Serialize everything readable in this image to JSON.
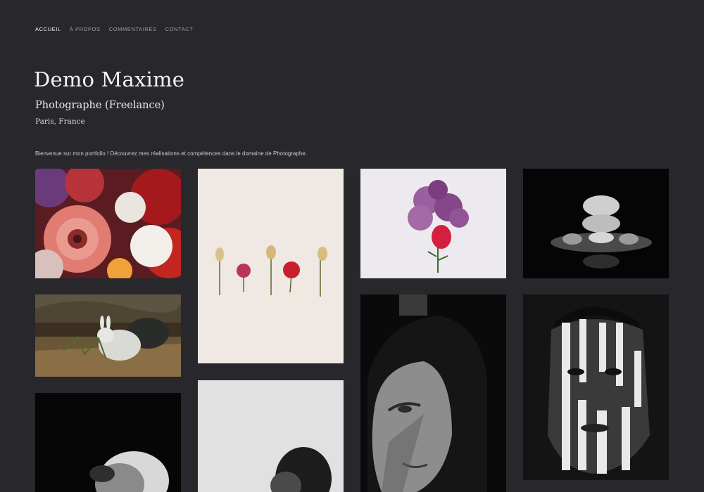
{
  "nav": {
    "items": [
      "ACCUEIL",
      "À PROPOS",
      "COMMENTAIRES",
      "CONTACT"
    ]
  },
  "header": {
    "name": "Demo Maxime",
    "role": "Photographe (Freelance)",
    "location": "Paris, France"
  },
  "intro": "Bienvenue sur mon portfolio ! Découvrez mes réalisations et compétences dans le domaine de Photographe.",
  "colors": {
    "background": "#27272c",
    "text": "#f4f4f6",
    "nav_muted": "#9d9da4"
  }
}
